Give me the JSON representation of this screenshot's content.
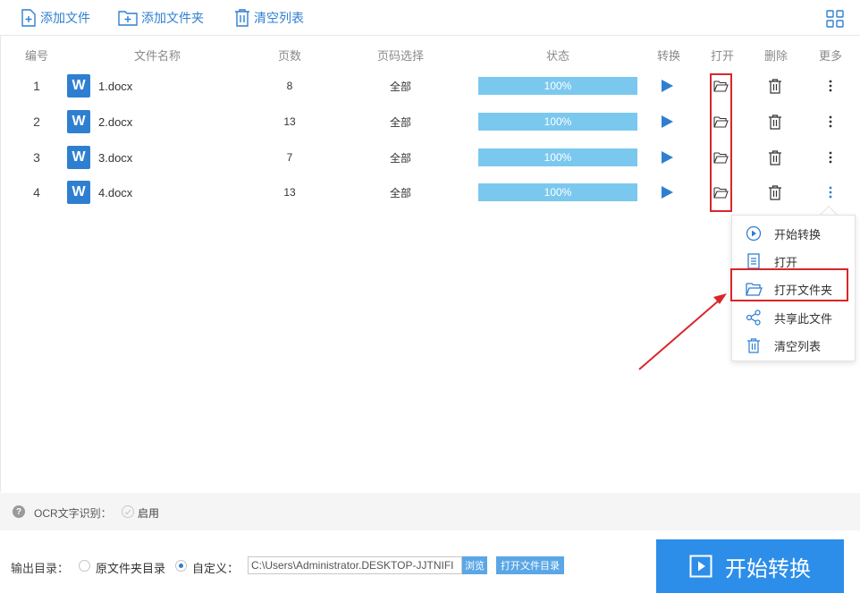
{
  "toolbar": {
    "add_file": "添加文件",
    "add_folder": "添加文件夹",
    "clear_list": "清空列表"
  },
  "table": {
    "headers": {
      "number": "编号",
      "filename": "文件名称",
      "pages": "页数",
      "page_range": "页码选择",
      "status": "状态",
      "convert": "转换",
      "open": "打开",
      "delete": "删除",
      "more": "更多"
    },
    "rows": [
      {
        "number": "1",
        "icon_letter": "W",
        "filename": "1.docx",
        "pages": "8",
        "range": "全部",
        "progress": 100,
        "status": "100%"
      },
      {
        "number": "2",
        "icon_letter": "W",
        "filename": "2.docx",
        "pages": "13",
        "range": "全部",
        "progress": 100,
        "status": "100%"
      },
      {
        "number": "3",
        "icon_letter": "W",
        "filename": "3.docx",
        "pages": "7",
        "range": "全部",
        "progress": 100,
        "status": "100%"
      },
      {
        "number": "4",
        "icon_letter": "W",
        "filename": "4.docx",
        "pages": "13",
        "range": "全部",
        "progress": 100,
        "status": "100%"
      }
    ]
  },
  "context_menu": {
    "items": [
      {
        "label": "开始转换",
        "icon": "play-circle-icon"
      },
      {
        "label": "打开",
        "icon": "document-icon"
      },
      {
        "label": "打开文件夹",
        "icon": "folder-open-icon"
      },
      {
        "label": "共享此文件",
        "icon": "share-icon"
      },
      {
        "label": "清空列表",
        "icon": "trash-icon"
      }
    ]
  },
  "ocr": {
    "help_glyph": "?",
    "label": "OCR文字识别：",
    "enable_label": "启用"
  },
  "output": {
    "label": "输出目录：",
    "option_original": "原文件夹目录",
    "option_custom": "自定义：",
    "path_value": "C:\\Users\\Administrator.DESKTOP-JJTNIFI",
    "browse": "浏览",
    "open_folder": "打开文件目录"
  },
  "start_button": {
    "label": "开始转换"
  },
  "colors": {
    "accent": "#2f7fd1",
    "progress_fill": "#7bc8ef",
    "highlight": "#d9262c",
    "start_button": "#2d8eea"
  }
}
